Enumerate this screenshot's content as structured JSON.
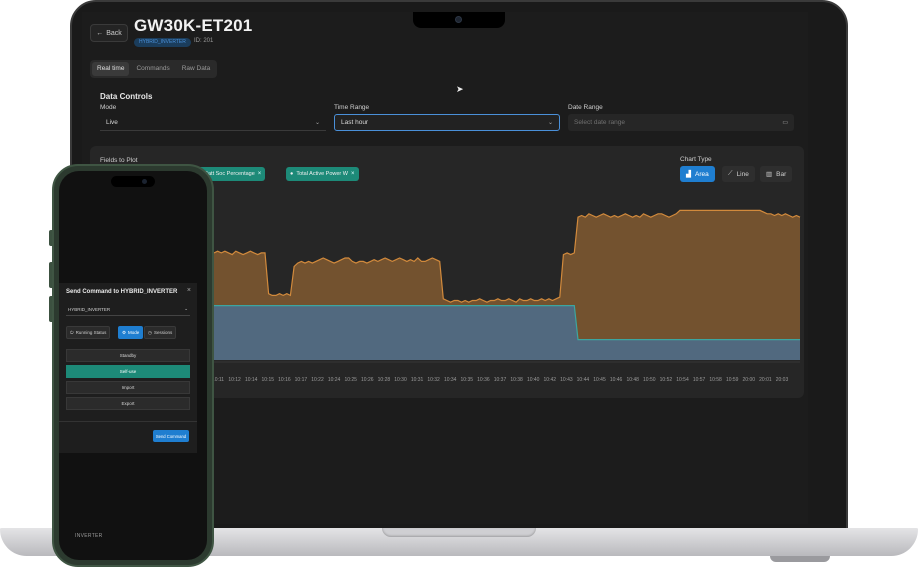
{
  "device": {
    "title": "GW30K-ET201",
    "badge": "HYBRID_INVERTER",
    "id_label": "ID: 201",
    "back_label": "Back"
  },
  "tabs": [
    {
      "label": "Real time",
      "active": true
    },
    {
      "label": "Commands",
      "active": false
    },
    {
      "label": "Raw Data",
      "active": false
    }
  ],
  "controls": {
    "section_title": "Data Controls",
    "mode": {
      "label": "Mode",
      "value": "Live"
    },
    "time_range": {
      "label": "Time Range",
      "value": "Last hour"
    },
    "date_range": {
      "label": "Date Range",
      "placeholder": "Select date range"
    }
  },
  "fields": {
    "label": "Fields to Plot",
    "chips": [
      "Batt Soc Percentage",
      "Total Active Power W"
    ]
  },
  "chart_type": {
    "label": "Chart Type",
    "options": [
      {
        "label": "Area",
        "active": true
      },
      {
        "label": "Line",
        "active": false
      },
      {
        "label": "Bar",
        "active": false
      }
    ]
  },
  "chart_data": {
    "type": "area",
    "x_labels": [
      "10:11",
      "10:12",
      "10:14",
      "10:15",
      "10:16",
      "10:17",
      "10:22",
      "10:24",
      "10:25",
      "10:26",
      "10:28",
      "10:30",
      "10:31",
      "10:32",
      "10:34",
      "10:35",
      "10:36",
      "10:37",
      "10:38",
      "10:40",
      "10:42",
      "10:43",
      "10:44",
      "10:45",
      "10:46",
      "10:48",
      "10:50",
      "10:52",
      "10:54",
      "10:57",
      "10:58",
      "10:59",
      "20:00",
      "20:01",
      "20:03"
    ],
    "series": [
      {
        "color": "#d28a3c",
        "values": [
          63,
          64,
          63,
          64,
          63,
          62,
          64,
          63,
          62,
          63,
          64,
          63,
          62,
          63,
          63,
          39,
          38,
          38,
          39,
          38,
          39,
          38,
          55,
          57,
          58,
          57,
          58,
          57,
          58,
          59,
          60,
          59,
          58,
          57,
          58,
          59,
          60,
          60,
          58,
          57,
          58,
          58,
          57,
          58,
          59,
          58,
          59,
          60,
          59,
          58,
          59,
          60,
          59,
          58,
          59,
          58,
          60,
          58,
          58,
          59,
          60,
          59,
          58,
          36,
          35,
          34,
          35,
          35,
          34,
          35,
          34,
          35,
          35,
          36,
          35,
          34,
          35,
          35,
          36,
          35,
          35,
          36,
          35,
          34,
          36,
          35,
          35,
          36,
          35,
          35,
          36,
          35,
          36,
          35,
          36,
          37,
          62,
          63,
          62,
          63,
          84,
          85,
          84,
          86,
          85,
          84,
          85,
          86,
          85,
          84,
          85,
          84,
          85,
          86,
          85,
          84,
          85,
          84,
          86,
          85,
          84,
          85,
          86,
          86,
          85,
          84,
          85,
          86,
          88,
          88,
          88,
          88,
          88,
          88,
          88,
          88,
          88,
          88,
          88,
          88,
          88,
          88,
          88,
          88,
          88,
          88,
          88,
          88,
          88,
          88,
          88,
          87,
          86,
          86,
          85,
          86,
          85,
          86,
          85,
          84,
          85,
          84
        ]
      },
      {
        "color": "#2f7fd0",
        "values": [
          32,
          32,
          32,
          32,
          32,
          32,
          32,
          32,
          32,
          32,
          32,
          32,
          32,
          32,
          32,
          32,
          32,
          32,
          32,
          32,
          32,
          32,
          32,
          32,
          32,
          32,
          32,
          32,
          32,
          32,
          32,
          32,
          32,
          32,
          32,
          32,
          32,
          32,
          32,
          32,
          32,
          32,
          32,
          32,
          32,
          32,
          32,
          32,
          32,
          32,
          32,
          32,
          32,
          32,
          32,
          32,
          32,
          32,
          32,
          32,
          32,
          32,
          32,
          32,
          32,
          32,
          32,
          32,
          32,
          32,
          32,
          32,
          32,
          32,
          32,
          32,
          32,
          32,
          32,
          32,
          32,
          32,
          32,
          32,
          32,
          32,
          32,
          32,
          32,
          32,
          32,
          32,
          32,
          32,
          32,
          32,
          32,
          32,
          32,
          32,
          12,
          12,
          12,
          12,
          12,
          12,
          12,
          12,
          12,
          12,
          12,
          12,
          12,
          12,
          12,
          12,
          12,
          12,
          12,
          12,
          12,
          12,
          12,
          12,
          12,
          12,
          12,
          12,
          12,
          12,
          12,
          12,
          12,
          12,
          12,
          12,
          12,
          12,
          12,
          12,
          12,
          12,
          12,
          12,
          12,
          12,
          12,
          12,
          12,
          12,
          12,
          12,
          12,
          12,
          12,
          12,
          12,
          12,
          12,
          12,
          12,
          12
        ]
      }
    ],
    "ylim": [
      0,
      100
    ],
    "grid": false,
    "legend": "none"
  },
  "phone": {
    "modal_title": "Send Command to HYBRID_INVERTER",
    "select_value": "HYBRID_INVERTER",
    "segments": [
      {
        "label": "Running Status",
        "active": false
      },
      {
        "label": "Mode",
        "active": true
      },
      {
        "label": "Sessions",
        "active": false
      }
    ],
    "options": [
      {
        "label": "Standby",
        "selected": false
      },
      {
        "label": "Self-use",
        "selected": true
      },
      {
        "label": "Import",
        "selected": false
      },
      {
        "label": "Export",
        "selected": false
      }
    ],
    "send_label": "Send Command",
    "footer": "INVERTER"
  },
  "colors": {
    "accent": "#1f7ed0",
    "chip": "#1d8a78",
    "series1": "#d28a3c",
    "series2": "#2f7fd0"
  }
}
